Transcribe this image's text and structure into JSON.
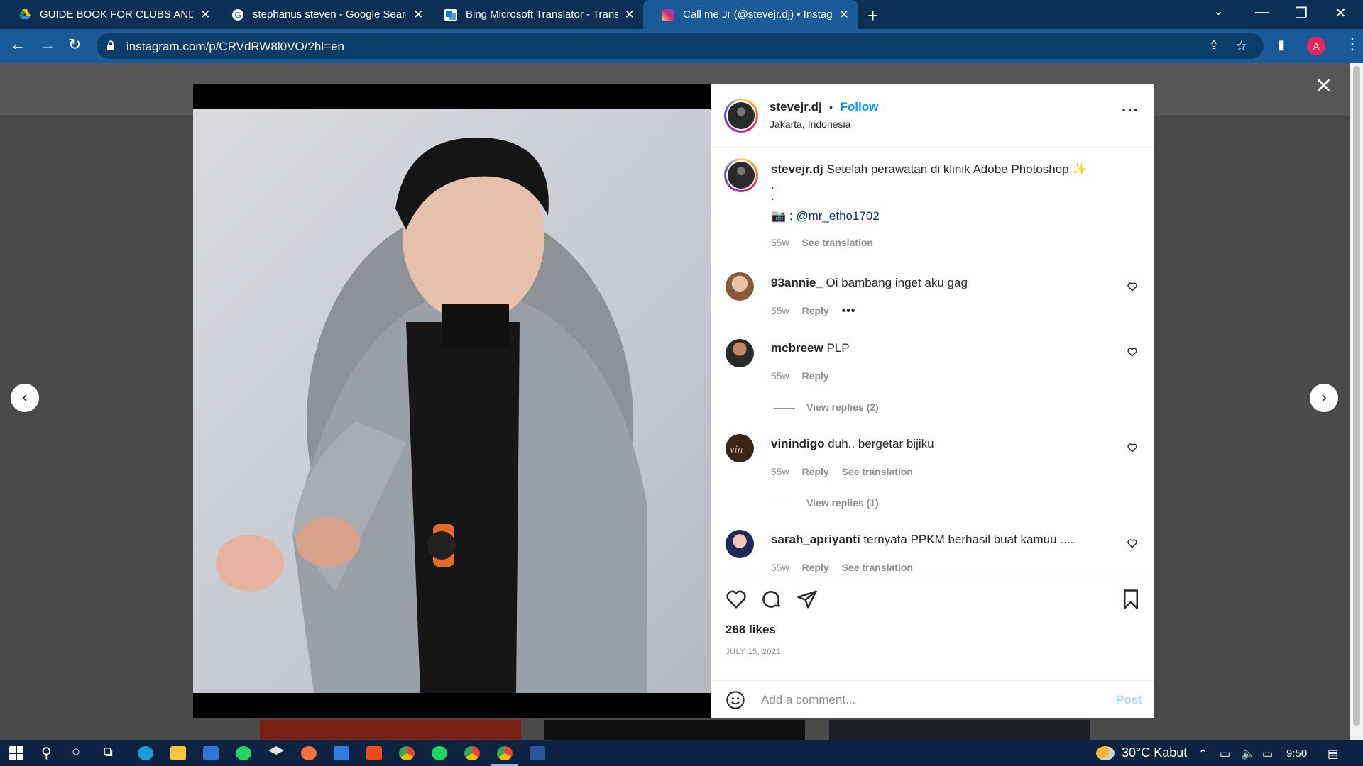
{
  "browser": {
    "tabs": [
      {
        "title": "GUIDE BOOK FOR CLUBS AND C",
        "favicon": "google-drive-icon"
      },
      {
        "title": "stephanus steven - Google Searc",
        "favicon": "google-icon"
      },
      {
        "title": "Bing Microsoft Translator - Transl",
        "favicon": "translator-icon"
      },
      {
        "title": "Call me Jr (@stevejr.dj) • Instag",
        "favicon": "instagram-icon"
      }
    ],
    "url": "instagram.com/p/CRVdRW8l0VO/?hl=en",
    "profile_initial": "A"
  },
  "post": {
    "username": "stevejr.dj",
    "follow_label": "Follow",
    "dot": "•",
    "location": "Jakarta, Indonesia",
    "caption": "Setelah perawatan di klinik Adobe Photoshop ✨",
    "caption_line2": ".",
    "caption_line3": ".",
    "caption_camera": "📷 :",
    "caption_mention": "@mr_etho1702",
    "caption_age": "55w",
    "see_translation": "See translation",
    "likes": "268 likes",
    "date": "JULY 15, 2021",
    "comment_placeholder": "Add a comment...",
    "post_label": "Post"
  },
  "comments": [
    {
      "user": "93annie_",
      "text": "Oi bambang inget aku gag",
      "age": "55w",
      "reply": "Reply",
      "extra": "•••"
    },
    {
      "user": "mcbreew",
      "text": "PLP",
      "age": "55w",
      "reply": "Reply",
      "replies": "View replies (2)"
    },
    {
      "user": "vinindigo",
      "text": "duh.. bergetar bijiku",
      "age": "55w",
      "reply": "Reply",
      "translation": "See translation",
      "replies": "View replies (1)"
    },
    {
      "user": "sarah_apriyanti",
      "text": "ternyata PPKM berhasil buat kamuu .....",
      "age": "55w",
      "reply": "Reply",
      "translation": "See translation"
    }
  ],
  "taskbar": {
    "weather": "30°C Kabut",
    "time": "9:50"
  },
  "colors": {
    "tabstrip": "#0b2f55",
    "toolbar": "#1a5a99",
    "follow_blue": "#0095f6",
    "taskbar": "#0e2341"
  }
}
